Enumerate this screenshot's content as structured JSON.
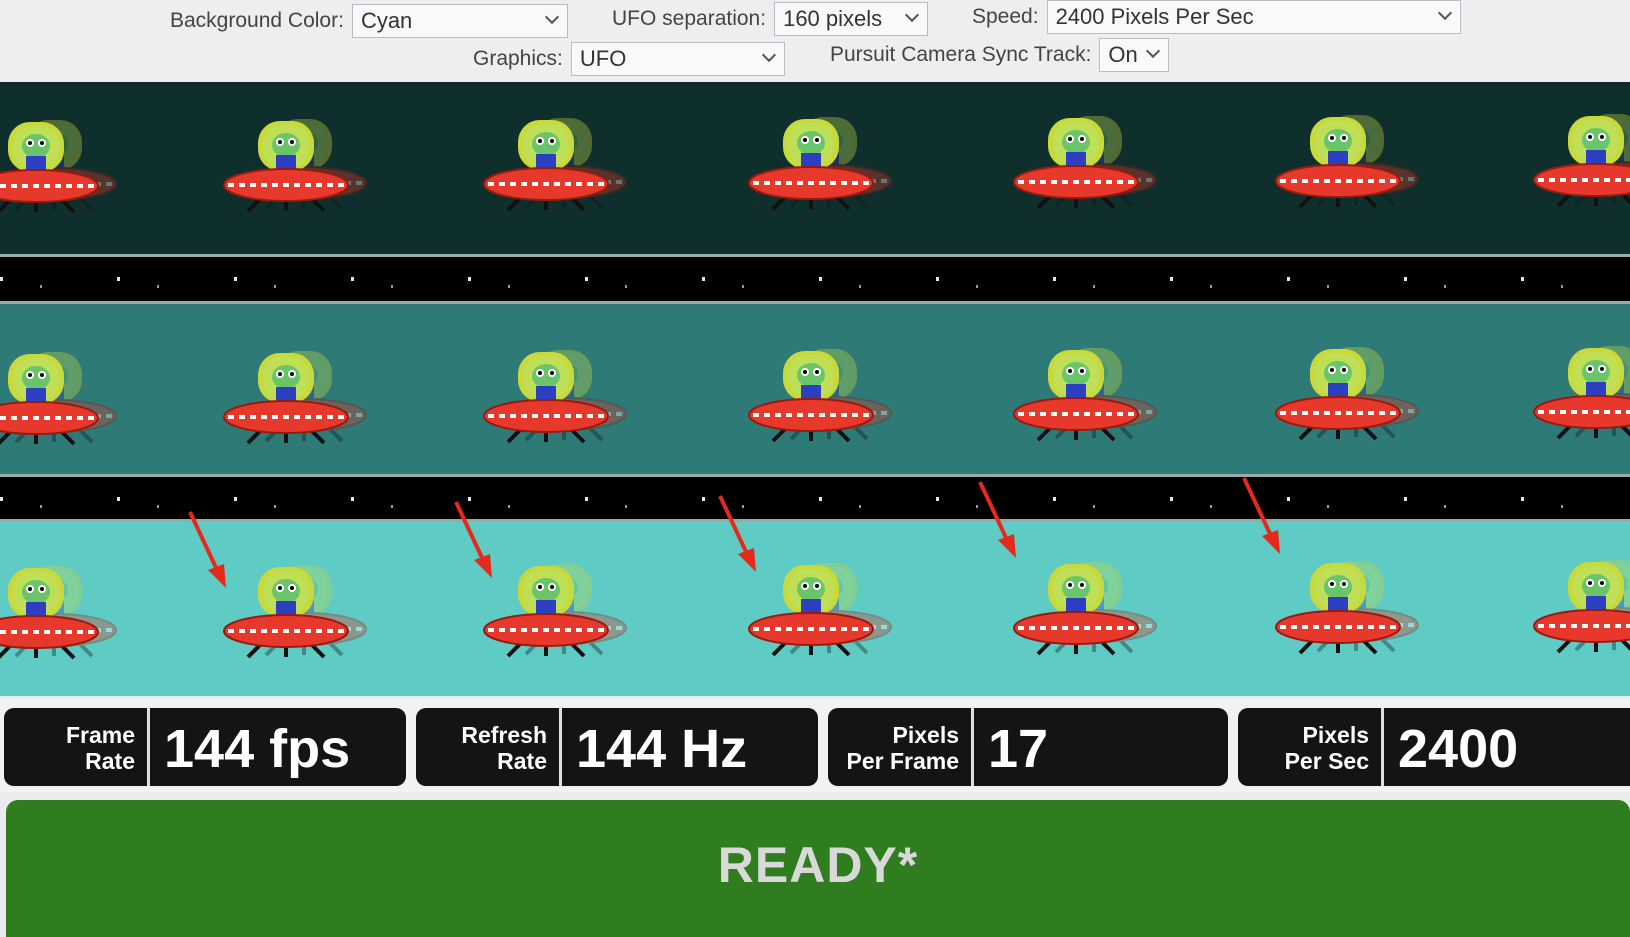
{
  "controls": {
    "background_color": {
      "label": "Background Color:",
      "value": "Cyan"
    },
    "ufo_separation": {
      "label": "UFO separation:",
      "value": "160 pixels"
    },
    "speed": {
      "label": "Speed:",
      "value": "2400 Pixels Per Sec"
    },
    "graphics": {
      "label": "Graphics:",
      "value": "UFO"
    },
    "pursuit_camera": {
      "label": "Pursuit Camera Sync Track:",
      "value": "On"
    }
  },
  "lanes": [
    {
      "name": "dark",
      "color": "#0f2f2d"
    },
    {
      "name": "medium",
      "color": "#2d7a77"
    },
    {
      "name": "light",
      "color": "#5ecbc4"
    }
  ],
  "annotation_color": "#e52a1c",
  "stats": [
    {
      "label_line1": "Frame",
      "label_line2": "Rate",
      "value": "144 fps"
    },
    {
      "label_line1": "Refresh",
      "label_line2": "Rate",
      "value": "144 Hz"
    },
    {
      "label_line1": "Pixels",
      "label_line2": "Per Frame",
      "value": "17"
    },
    {
      "label_line1": "Pixels",
      "label_line2": "Per Sec",
      "value": "2400"
    }
  ],
  "status": {
    "text": "READY*",
    "color": "#2f7d1e"
  }
}
